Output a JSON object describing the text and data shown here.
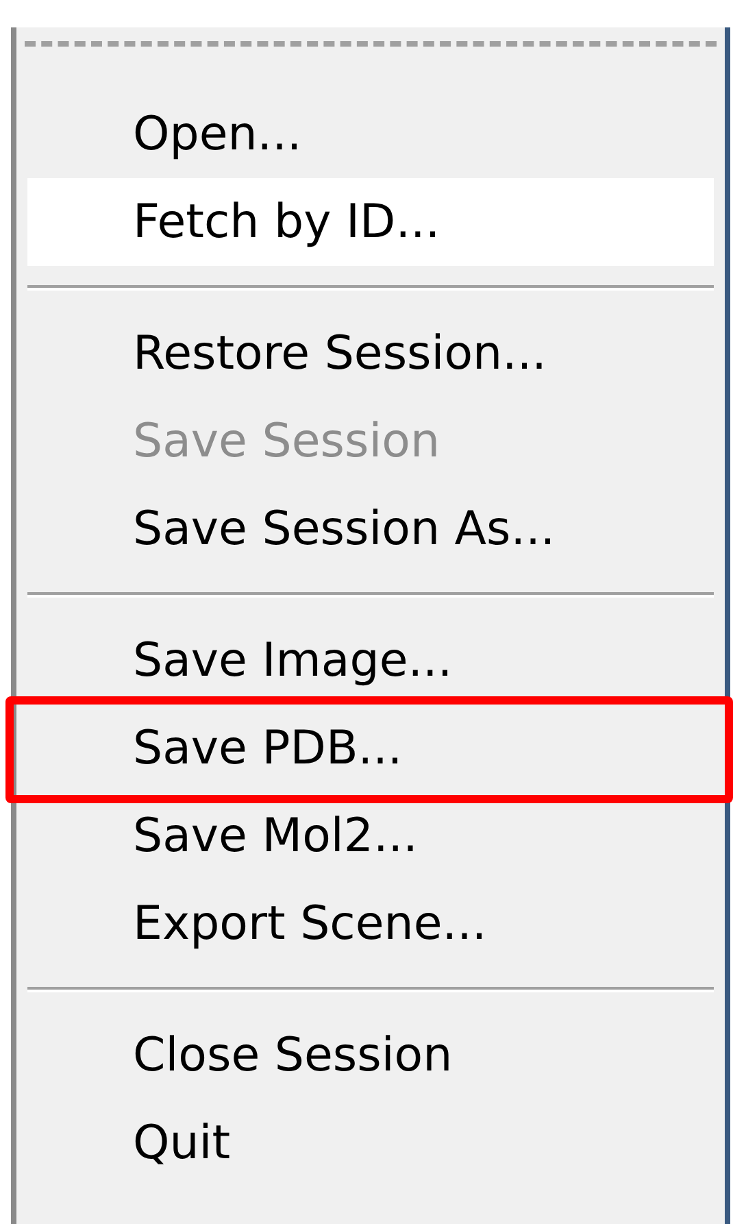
{
  "menu": {
    "tear_off": true,
    "sections": [
      {
        "items": [
          {
            "label": "Open...",
            "selected": false,
            "disabled": false,
            "annotated": false
          },
          {
            "label": "Fetch by ID...",
            "selected": true,
            "disabled": false,
            "annotated": false
          }
        ]
      },
      {
        "items": [
          {
            "label": "Restore Session...",
            "selected": false,
            "disabled": false,
            "annotated": false
          },
          {
            "label": "Save Session",
            "selected": false,
            "disabled": true,
            "annotated": false
          },
          {
            "label": "Save Session As...",
            "selected": false,
            "disabled": false,
            "annotated": false
          }
        ]
      },
      {
        "items": [
          {
            "label": "Save Image...",
            "selected": false,
            "disabled": false,
            "annotated": false
          },
          {
            "label": "Save PDB...",
            "selected": false,
            "disabled": false,
            "annotated": true
          },
          {
            "label": "Save Mol2...",
            "selected": false,
            "disabled": false,
            "annotated": false
          },
          {
            "label": "Export Scene...",
            "selected": false,
            "disabled": false,
            "annotated": false
          }
        ]
      },
      {
        "items": [
          {
            "label": "Close Session",
            "selected": false,
            "disabled": false,
            "annotated": false
          },
          {
            "label": "Quit",
            "selected": false,
            "disabled": false,
            "annotated": false
          }
        ]
      }
    ]
  }
}
